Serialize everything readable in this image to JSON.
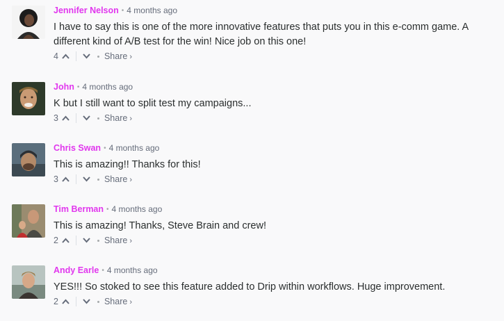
{
  "comments": [
    {
      "author": "Jennifer Nelson",
      "time": "4 months ago",
      "text": "I have to say this is one of the more innovative features that puts you in this e-comm game. A different kind of A/B test for the win! Nice job on this one!",
      "upvotes": "4",
      "share_label": "Share",
      "share_chevron": "›"
    },
    {
      "author": "John",
      "time": "4 months ago",
      "text": "K but I still want to split test my campaigns...",
      "upvotes": "3",
      "share_label": "Share",
      "share_chevron": "›"
    },
    {
      "author": "Chris Swan",
      "time": "4 months ago",
      "text": "This is amazing!! Thanks for this!",
      "upvotes": "3",
      "share_label": "Share",
      "share_chevron": "›"
    },
    {
      "author": "Tim Berman",
      "time": "4 months ago",
      "text": "This is amazing! Thanks, Steve Brain and crew!",
      "upvotes": "2",
      "share_label": "Share",
      "share_chevron": "›"
    },
    {
      "author": "Andy Earle",
      "time": "4 months ago",
      "text": "YES!!! So stoked to see this feature added to Drip within workflows. Huge improvement.",
      "upvotes": "2",
      "share_label": "Share",
      "share_chevron": "›"
    }
  ],
  "header_separator": "•",
  "colors": {
    "author": "#e137ee",
    "text": "#2a2e2e",
    "meta": "#656c7a",
    "background": "#f9f9fa"
  },
  "icons": {
    "upvote": "chevron-up-icon",
    "downvote": "chevron-down-icon"
  }
}
